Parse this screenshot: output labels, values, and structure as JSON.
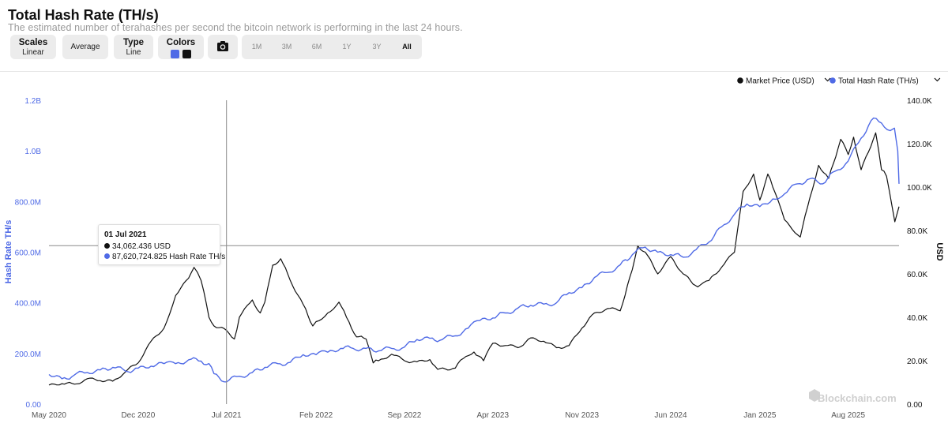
{
  "header": {
    "title": "Total Hash Rate (TH/s)",
    "subtitle": "The estimated number of terahashes per second the bitcoin network is performing in the last 24 hours."
  },
  "toolbar": {
    "scales": {
      "label": "Scales",
      "value": "Linear"
    },
    "average": {
      "label": "Average"
    },
    "type": {
      "label": "Type",
      "value": "Line"
    },
    "colors": {
      "label": "Colors",
      "swatch1": "#4f6ae6",
      "swatch2": "#111111"
    },
    "camera_icon": "camera-icon",
    "ranges": [
      "1M",
      "3M",
      "6M",
      "1Y",
      "3Y",
      "All"
    ],
    "active_range": "All"
  },
  "tooltip": {
    "date": "01 Jul 2021",
    "price_line": "34,062.436 USD",
    "hash_line": "87,620,724.825 Hash Rate TH/s"
  },
  "watermark": "Blockchain.com",
  "chart_data": {
    "type": "line",
    "x_ticks": [
      "May 2020",
      "Dec 2020",
      "Jul 2021",
      "Feb 2022",
      "Sep 2022",
      "Apr 2023",
      "Nov 2023",
      "Jun 2024",
      "Jan 2025",
      "Aug 2025"
    ],
    "x_tick_dates": [
      "2020-05-01",
      "2020-12-01",
      "2021-07-01",
      "2022-02-01",
      "2022-09-01",
      "2023-04-01",
      "2023-11-01",
      "2024-06-01",
      "2025-01-01",
      "2025-08-01"
    ],
    "x_range": [
      "2020-05-01",
      "2025-12-01"
    ],
    "y_left": {
      "label": "Hash Rate TH/s",
      "ticks": [
        "0.00",
        "200.0M",
        "400.0M",
        "600.0M",
        "800.0M",
        "1.0B",
        "1.2B"
      ],
      "range": [
        0,
        1200000000
      ],
      "color": "#4f6ae6"
    },
    "y_right": {
      "label": "USD",
      "ticks": [
        "0.00",
        "20.0K",
        "40.0K",
        "60.0K",
        "80.0K",
        "100.0K",
        "120.0K",
        "140.0K"
      ],
      "range": [
        0,
        140000
      ]
    },
    "legend": {
      "position": "top-right"
    },
    "crosshair": {
      "date": "2021-07-01",
      "y_value_usd": 73000
    },
    "series": [
      {
        "name": "Market Price (USD)",
        "axis": "right",
        "color": "#111111",
        "points": [
          [
            "2020-05-01",
            8800
          ],
          [
            "2020-06-01",
            9400
          ],
          [
            "2020-07-01",
            9200
          ],
          [
            "2020-08-01",
            11700
          ],
          [
            "2020-09-01",
            10800
          ],
          [
            "2020-10-01",
            10600
          ],
          [
            "2020-11-01",
            15000
          ],
          [
            "2020-12-01",
            19000
          ],
          [
            "2021-01-01",
            29000
          ],
          [
            "2021-02-01",
            35000
          ],
          [
            "2021-03-01",
            50000
          ],
          [
            "2021-04-01",
            58000
          ],
          [
            "2021-04-14",
            63000
          ],
          [
            "2021-05-01",
            57000
          ],
          [
            "2021-05-20",
            40000
          ],
          [
            "2021-06-01",
            36000
          ],
          [
            "2021-07-01",
            34000
          ],
          [
            "2021-07-20",
            30000
          ],
          [
            "2021-08-01",
            40000
          ],
          [
            "2021-09-01",
            48000
          ],
          [
            "2021-09-20",
            42000
          ],
          [
            "2021-10-01",
            47000
          ],
          [
            "2021-10-20",
            64000
          ],
          [
            "2021-11-08",
            67000
          ],
          [
            "2021-12-01",
            57000
          ],
          [
            "2022-01-01",
            46000
          ],
          [
            "2022-01-24",
            36000
          ],
          [
            "2022-02-01",
            38000
          ],
          [
            "2022-03-01",
            42000
          ],
          [
            "2022-03-28",
            47000
          ],
          [
            "2022-04-15",
            40000
          ],
          [
            "2022-05-09",
            31000
          ],
          [
            "2022-06-01",
            30000
          ],
          [
            "2022-06-18",
            19000
          ],
          [
            "2022-07-01",
            20000
          ],
          [
            "2022-08-01",
            23000
          ],
          [
            "2022-09-01",
            20000
          ],
          [
            "2022-10-01",
            19500
          ],
          [
            "2022-11-01",
            20500
          ],
          [
            "2022-11-20",
            16000
          ],
          [
            "2023-01-01",
            16600
          ],
          [
            "2023-01-20",
            21000
          ],
          [
            "2023-02-15",
            24000
          ],
          [
            "2023-03-10",
            20000
          ],
          [
            "2023-04-01",
            28000
          ],
          [
            "2023-05-01",
            27000
          ],
          [
            "2023-06-01",
            26000
          ],
          [
            "2023-07-01",
            30500
          ],
          [
            "2023-08-01",
            29000
          ],
          [
            "2023-09-01",
            26000
          ],
          [
            "2023-10-01",
            27000
          ],
          [
            "2023-11-01",
            35000
          ],
          [
            "2023-12-01",
            42000
          ],
          [
            "2024-01-01",
            44000
          ],
          [
            "2024-02-01",
            43000
          ],
          [
            "2024-03-01",
            62000
          ],
          [
            "2024-03-14",
            73000
          ],
          [
            "2024-04-01",
            70000
          ],
          [
            "2024-05-01",
            60000
          ],
          [
            "2024-06-01",
            68000
          ],
          [
            "2024-07-01",
            60000
          ],
          [
            "2024-08-05",
            54000
          ],
          [
            "2024-09-01",
            57000
          ],
          [
            "2024-10-01",
            63000
          ],
          [
            "2024-11-01",
            70000
          ],
          [
            "2024-11-22",
            98000
          ],
          [
            "2024-12-17",
            106000
          ],
          [
            "2025-01-01",
            94000
          ],
          [
            "2025-01-20",
            106000
          ],
          [
            "2025-02-01",
            100000
          ],
          [
            "2025-03-01",
            85000
          ],
          [
            "2025-04-08",
            77000
          ],
          [
            "2025-05-01",
            95000
          ],
          [
            "2025-05-22",
            110000
          ],
          [
            "2025-06-15",
            104000
          ],
          [
            "2025-07-14",
            122000
          ],
          [
            "2025-08-01",
            115000
          ],
          [
            "2025-08-14",
            123000
          ],
          [
            "2025-09-01",
            108000
          ],
          [
            "2025-10-06",
            125000
          ],
          [
            "2025-10-20",
            108000
          ],
          [
            "2025-11-01",
            105000
          ],
          [
            "2025-11-21",
            84000
          ],
          [
            "2025-12-01",
            91000
          ]
        ]
      },
      {
        "name": "Total Hash Rate (TH/s)",
        "axis": "left",
        "color": "#4f6ae6",
        "points": [
          [
            "2020-05-01",
            117000000
          ],
          [
            "2020-06-01",
            100000000
          ],
          [
            "2020-07-01",
            115000000
          ],
          [
            "2020-08-01",
            125000000
          ],
          [
            "2020-09-01",
            135000000
          ],
          [
            "2020-10-01",
            145000000
          ],
          [
            "2020-11-01",
            130000000
          ],
          [
            "2020-12-01",
            142000000
          ],
          [
            "2021-01-01",
            150000000
          ],
          [
            "2021-02-01",
            160000000
          ],
          [
            "2021-03-01",
            160000000
          ],
          [
            "2021-04-01",
            175000000
          ],
          [
            "2021-05-01",
            170000000
          ],
          [
            "2021-05-20",
            160000000
          ],
          [
            "2021-06-01",
            120000000
          ],
          [
            "2021-07-01",
            87600000
          ],
          [
            "2021-08-01",
            110000000
          ],
          [
            "2021-09-01",
            125000000
          ],
          [
            "2021-10-01",
            145000000
          ],
          [
            "2021-11-01",
            160000000
          ],
          [
            "2021-12-01",
            165000000
          ],
          [
            "2022-01-01",
            195000000
          ],
          [
            "2022-02-01",
            195000000
          ],
          [
            "2022-03-01",
            205000000
          ],
          [
            "2022-04-01",
            220000000
          ],
          [
            "2022-05-01",
            220000000
          ],
          [
            "2022-06-01",
            220000000
          ],
          [
            "2022-07-01",
            210000000
          ],
          [
            "2022-08-01",
            220000000
          ],
          [
            "2022-09-01",
            225000000
          ],
          [
            "2022-10-01",
            255000000
          ],
          [
            "2022-11-01",
            260000000
          ],
          [
            "2022-12-01",
            255000000
          ],
          [
            "2023-01-01",
            270000000
          ],
          [
            "2023-02-01",
            300000000
          ],
          [
            "2023-03-01",
            330000000
          ],
          [
            "2023-04-01",
            340000000
          ],
          [
            "2023-05-01",
            360000000
          ],
          [
            "2023-06-01",
            380000000
          ],
          [
            "2023-07-01",
            390000000
          ],
          [
            "2023-08-01",
            395000000
          ],
          [
            "2023-09-01",
            400000000
          ],
          [
            "2023-10-01",
            440000000
          ],
          [
            "2023-11-01",
            460000000
          ],
          [
            "2023-12-01",
            500000000
          ],
          [
            "2024-01-01",
            520000000
          ],
          [
            "2024-02-01",
            550000000
          ],
          [
            "2024-03-01",
            590000000
          ],
          [
            "2024-04-01",
            620000000
          ],
          [
            "2024-05-01",
            600000000
          ],
          [
            "2024-06-01",
            590000000
          ],
          [
            "2024-07-01",
            580000000
          ],
          [
            "2024-08-01",
            610000000
          ],
          [
            "2024-09-01",
            640000000
          ],
          [
            "2024-10-01",
            700000000
          ],
          [
            "2024-11-01",
            750000000
          ],
          [
            "2024-12-01",
            790000000
          ],
          [
            "2025-01-01",
            780000000
          ],
          [
            "2025-02-01",
            810000000
          ],
          [
            "2025-03-01",
            830000000
          ],
          [
            "2025-04-01",
            870000000
          ],
          [
            "2025-05-01",
            890000000
          ],
          [
            "2025-06-01",
            870000000
          ],
          [
            "2025-07-01",
            920000000
          ],
          [
            "2025-08-01",
            960000000
          ],
          [
            "2025-09-01",
            1050000000
          ],
          [
            "2025-10-01",
            1130000000
          ],
          [
            "2025-10-20",
            1110000000
          ],
          [
            "2025-11-10",
            1080000000
          ],
          [
            "2025-11-20",
            1090000000
          ],
          [
            "2025-11-28",
            1000000000
          ],
          [
            "2025-12-01",
            870000000
          ]
        ]
      }
    ]
  }
}
